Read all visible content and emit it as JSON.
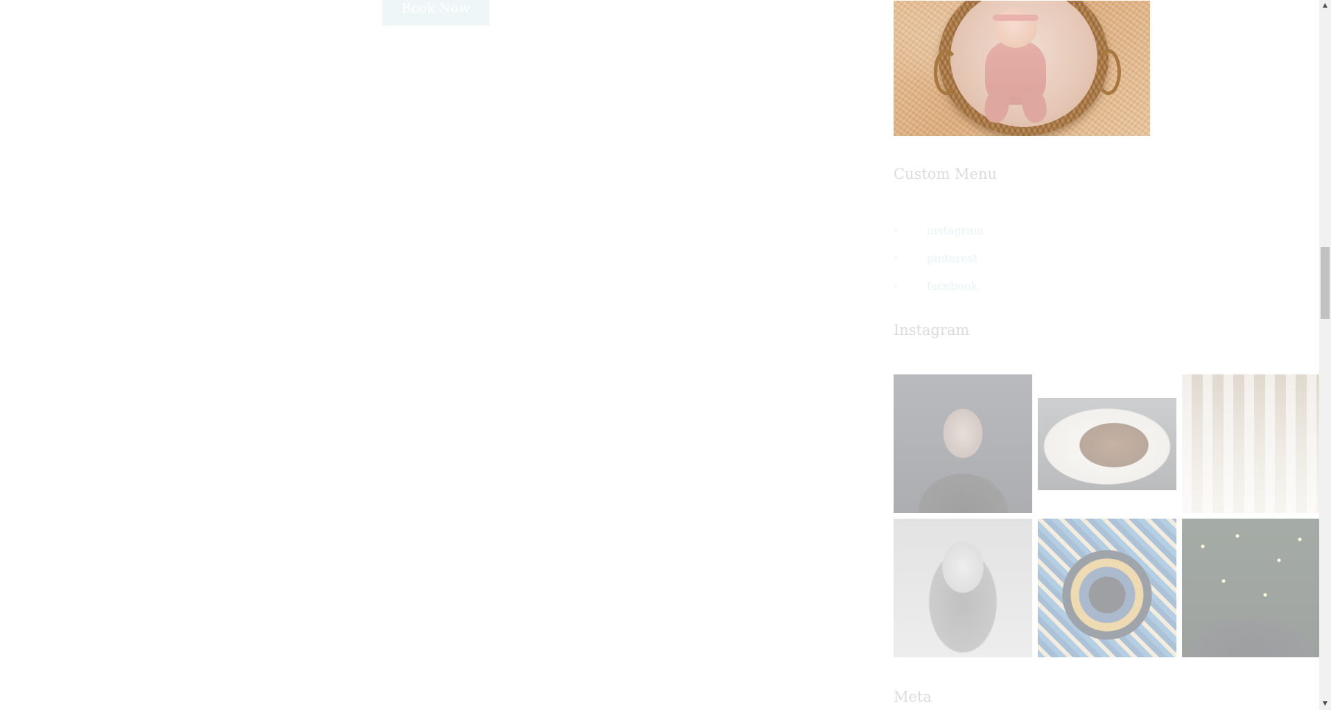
{
  "main": {
    "book_button_label": "Book Now"
  },
  "sidebar": {
    "custom_menu": {
      "title": "Custom Menu",
      "arrow_glyph": "›",
      "items": [
        {
          "label": "instagram"
        },
        {
          "label": "pinterest"
        },
        {
          "label": "facebook"
        }
      ]
    },
    "instagram": {
      "title": "Instagram"
    },
    "meta": {
      "title": "Meta"
    }
  },
  "scrollbar": {
    "up_glyph": "▲",
    "down_glyph": "▼"
  },
  "colors": {
    "button_bg": "#eef6f7",
    "widget_title": "#dcdcdc",
    "menu_link": "#e8f3f5"
  }
}
